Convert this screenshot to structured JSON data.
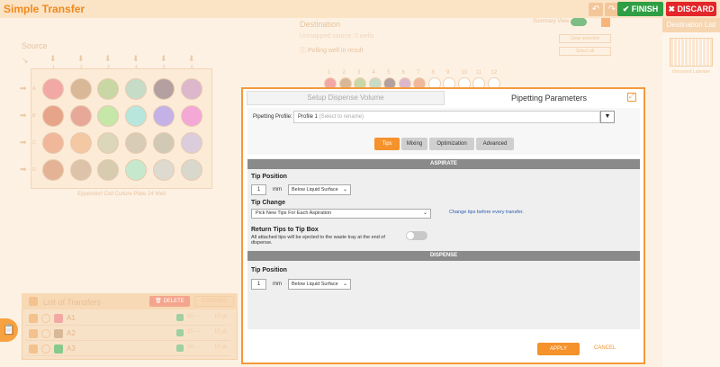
{
  "app": {
    "title": "Simple Transfer"
  },
  "toolbar": {
    "undo_icon": "undo-icon",
    "redo_icon": "redo-icon",
    "finish_label": "FINISH",
    "discard_label": "DISCARD"
  },
  "colors": {
    "accent": "#f5922b",
    "finish": "#2f9e44",
    "discard": "#e3262a",
    "section_bar": "#8a8a8a"
  },
  "source": {
    "label": "Source",
    "plate_name": "Eppendorf Cell Culture Plate 24 Well",
    "columns": [
      "1",
      "2",
      "3",
      "4",
      "5",
      "6"
    ],
    "rows": [
      "A",
      "B",
      "C",
      "D"
    ],
    "well_colors": [
      [
        "#f2a8a4",
        "#d9b898",
        "#c9d7a4",
        "#c7dcc7",
        "#b4a0a0",
        "#ddb8cc"
      ],
      [
        "#e6a489",
        "#e8a899",
        "#c5e7a8",
        "#b8e6dc",
        "#c3b1e8",
        "#f4a8d6"
      ],
      [
        "#f0b79b",
        "#f4c8a2",
        "#dcd6ba",
        "#d9ccb6",
        "#d2c9b4",
        "#dccddd"
      ],
      [
        "#e4b396",
        "#ddc3aa",
        "#d7cbb0",
        "#c6e8cd",
        "#dedad0",
        "#d8d8cc"
      ]
    ]
  },
  "destination": {
    "label": "Destination",
    "unmapped": "Unmapped source: 0 wells",
    "polling": "Polling well in result",
    "summary_view": "Summary View",
    "buttons": [
      "Clear selection",
      "Select all"
    ],
    "columns": [
      "1",
      "2",
      "3",
      "4",
      "5",
      "6",
      "7",
      "8",
      "9",
      "10",
      "11",
      "12"
    ],
    "well_colors": [
      "#f2a8a4",
      "#d9b898",
      "#c9d7a4",
      "#c7dcc7",
      "#b4a0a0",
      "#ddb8cc",
      "#f0b79b",
      "",
      "",
      "",
      "",
      ""
    ]
  },
  "destination_list": {
    "header": "Destination List",
    "thumb_label": "Unnamed Labware"
  },
  "transfers": {
    "title": "List of Transfers",
    "delete_label": "DELETE",
    "extra_label": "CONFIRM",
    "rows": [
      {
        "name": "A1",
        "color": "#f2a8a4",
        "val": "10 —",
        "unit": "10 µL"
      },
      {
        "name": "A2",
        "color": "#d9b898",
        "val": "10 —",
        "unit": "10 µL"
      },
      {
        "name": "A3",
        "color": "#88c98d",
        "val": "10 —",
        "unit": "10 µL"
      }
    ]
  },
  "modal": {
    "left_tab": "Setup Dispense Volume",
    "title": "Pipetting Parameters",
    "profile_label": "Pipetting Profile:",
    "profile_value": "Profile 1",
    "profile_hint": "(Select to rename)",
    "tabs": [
      "Tips",
      "Mixing",
      "Optimization",
      "Advanced"
    ],
    "active_tab": "Tips",
    "aspirate": {
      "header": "ASPIRATE",
      "tip_position_label": "Tip Position",
      "tip_position_value": "1",
      "unit": "mm",
      "tip_position_ref": "Below Liquid Surface",
      "tip_change_label": "Tip Change",
      "tip_change_value": "Pick New Tips For Each Aspiration",
      "tip_change_note": "Change tips before every transfer.",
      "return_label": "Return Tips to Tip Box",
      "return_desc": "All attached tips will be ejected to the waste tray at the end of dispense.",
      "return_on": false
    },
    "dispense": {
      "header": "DISPENSE",
      "tip_position_label": "Tip Position",
      "tip_position_value": "1",
      "unit": "mm",
      "tip_position_ref": "Below Liquid Surface"
    },
    "apply_label": "APPLY",
    "cancel_label": "CANCEL"
  }
}
